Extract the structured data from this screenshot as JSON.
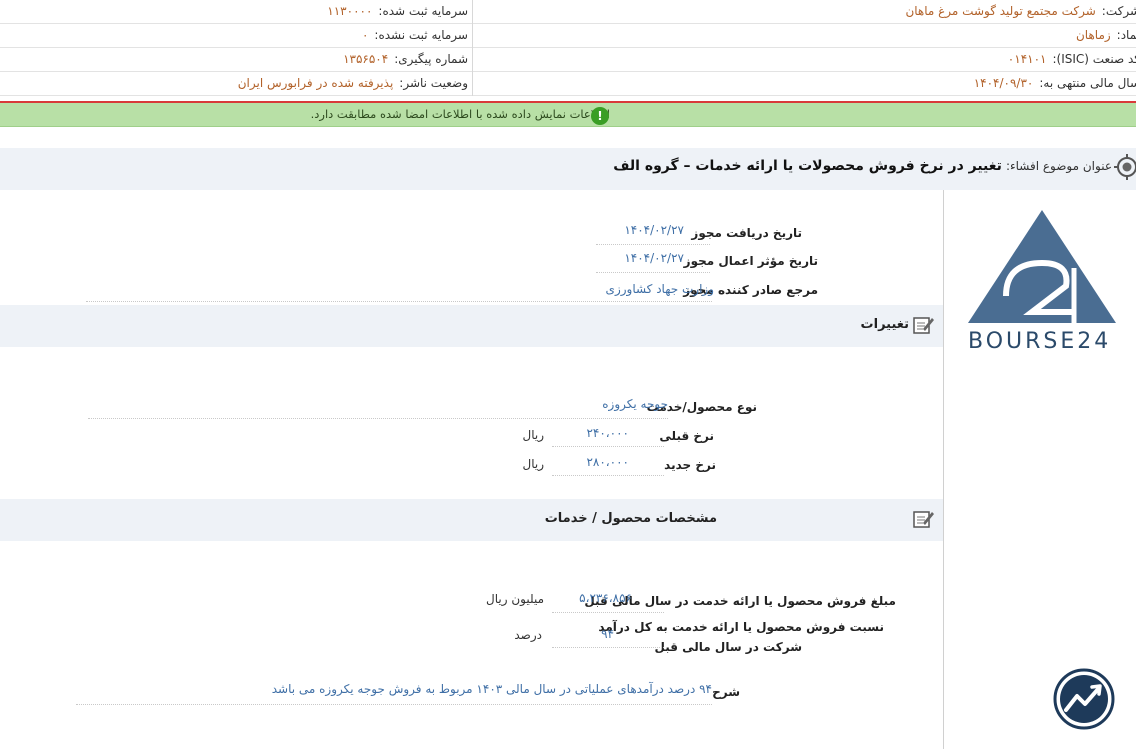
{
  "header": {
    "company_label": "شرکت:",
    "company_value": "شرکت مجتمع تولید گوشت مرغ ماهان",
    "registered_capital_label": "سرمایه ثبت شده:",
    "registered_capital_value": "۱۱۳۰۰۰۰",
    "symbol_label": "نماد:",
    "symbol_value": "زماهان",
    "unregistered_capital_label": "سرمایه ثبت نشده:",
    "unregistered_capital_value": "۰",
    "isic_label": "کد صنعت (ISIC):",
    "isic_value": "۰۱۴۱۰۱",
    "tracking_label": "شماره پیگیری:",
    "tracking_value": "۱۳۵۶۵۰۴",
    "fiscal_year_label": "سال مالی منتهی به:",
    "fiscal_year_value": "۱۴۰۴/۰۹/۳۰",
    "publisher_status_label": "وضعیت ناشر:",
    "publisher_status_value": "پذیرفته شده در فرابورس ایران"
  },
  "notice": {
    "message": "اطلاعات نمایش داده شده با اطلاعات امضا شده مطابقت دارد.",
    "icon": "info-icon",
    "icon_glyph": "!"
  },
  "subject": {
    "label": "عنوان موضوع افشاء:",
    "value": "تغییر در نرخ فروش محصولات یا ارائه خدمات – گروه الف"
  },
  "license": {
    "receive_date_label": "تاریخ دریافت مجوز",
    "receive_date_value": "۱۴۰۴/۰۲/۲۷",
    "effective_date_label": "تاریخ مؤثر اعمال مجوز",
    "effective_date_value": "۱۴۰۴/۰۲/۲۷",
    "issuer_label": "مرجع صادر کننده مجوز",
    "issuer_value": "وزارت جهاد کشاورزی"
  },
  "changes": {
    "title": "تغییرات",
    "product_type_label": "نوع محصول/خدمت",
    "product_type_value": "جوجه یکروزه",
    "prev_rate_label": "نرخ قبلی",
    "prev_rate_value": "۲۴۰،۰۰۰",
    "prev_rate_unit": "ریال",
    "new_rate_label": "نرخ جدید",
    "new_rate_value": "۲۸۰،۰۰۰",
    "new_rate_unit": "ریال"
  },
  "specs": {
    "title": "مشخصات محصول / خدمات",
    "sales_amount_label": "مبلغ فروش محصول یا ارائه خدمت در سال مالی قبل",
    "sales_amount_value": "۵،۲۳۶،۸۵۶",
    "sales_amount_unit": "میلیون ریال",
    "ratio_label_line1": "نسبت فروش محصول یا ارائه خدمت به کل درآمد",
    "ratio_label_line2": "شرکت در سال مالی قبل",
    "ratio_value": "۹۴",
    "ratio_unit": "درصد",
    "description_label": "شرح",
    "description_value": "۹۴ درصد درآمدهای عملیاتی در سال مالی ۱۴۰۳ مربوط به فروش جوجه یکروزه می باشد"
  },
  "logo": {
    "text": "BOURSE24",
    "color": "#4a6d92"
  },
  "colors": {
    "accent_value": "#b2622a",
    "link_value": "#3f6fa6",
    "notice_bg": "#b8e0a6",
    "alert_line": "#d93a3a"
  }
}
